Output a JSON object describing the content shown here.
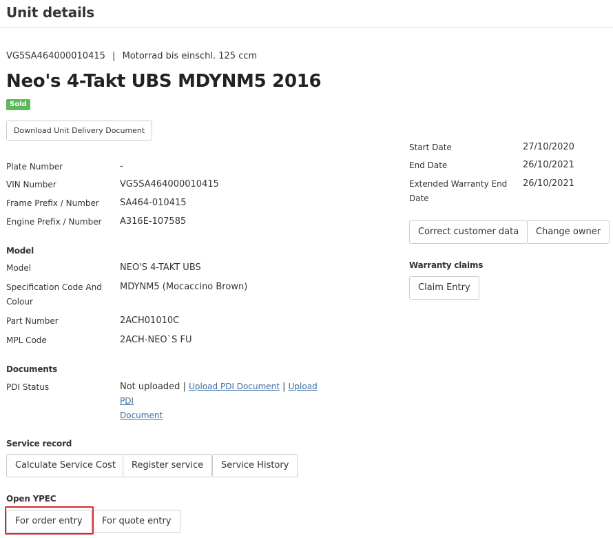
{
  "header": {
    "title": "Unit details"
  },
  "unit": {
    "vin": "VG5SA464000010415",
    "separator": "|",
    "category": "Motorrad bis einschl. 125 ccm",
    "title": "Neo's 4-Takt UBS MDYNM5 2016",
    "status_badge": "Sold",
    "download_button": "Download Unit Delivery Document"
  },
  "identity": {
    "plate_number_label": "Plate Number",
    "plate_number_value": "-",
    "vin_number_label": "VIN Number",
    "vin_number_value": "VG5SA464000010415",
    "frame_label": "Frame Prefix / Number",
    "frame_value": "SA464-010415",
    "engine_label": "Engine Prefix / Number",
    "engine_value": "A316E-107585"
  },
  "model": {
    "section_title": "Model",
    "model_label": "Model",
    "model_value": "NEO'S 4-TAKT UBS",
    "spec_label_line1": "Specification Code And",
    "spec_label_line2": "Colour",
    "spec_value": "MDYNM5 (Mocaccino Brown)",
    "part_label": "Part Number",
    "part_value": "2ACH01010C",
    "mpl_label": "MPL Code",
    "mpl_value": "2ACH-NEO`S FU"
  },
  "documents": {
    "section_title": "Documents",
    "pdi_label": "PDI Status",
    "pdi_status": "Not uploaded",
    "pdi_sep": "|",
    "upload_link_1": "Upload PDI Document",
    "upload_link_2_line1": "Upload PDI",
    "upload_link_2_line2": "Document"
  },
  "warranty": {
    "start_label": "Start Date",
    "start_value": "27/10/2020",
    "end_label": "End Date",
    "end_value": "26/10/2021",
    "ext_label_line1": "Extended Warranty End",
    "ext_label_line2": "Date",
    "ext_value": "26/10/2021",
    "correct_button": "Correct customer data",
    "change_owner_button": "Change owner",
    "claims_title": "Warranty claims",
    "claim_entry_button": "Claim Entry"
  },
  "service": {
    "section_title": "Service record",
    "calc_button": "Calculate Service Cost",
    "register_button": "Register service",
    "history_button": "Service History"
  },
  "ypec": {
    "section_title": "Open YPEC",
    "order_button": "For order entry",
    "quote_button": "For quote entry"
  }
}
